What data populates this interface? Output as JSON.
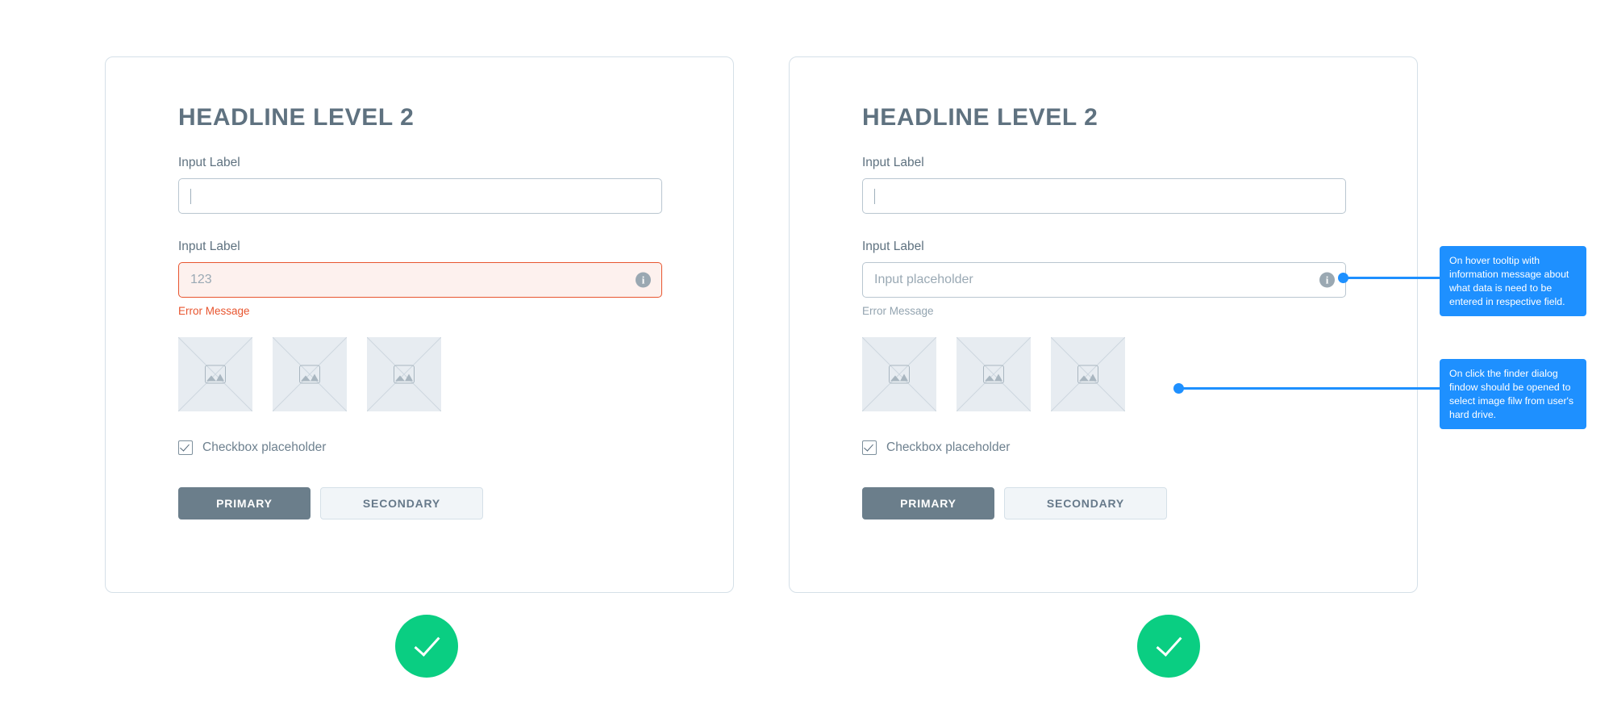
{
  "cards": [
    {
      "id": "left",
      "headline": "HEADLINE LEVEL 2",
      "field1": {
        "label": "Input Label",
        "value": "",
        "placeholder": ""
      },
      "field2": {
        "label": "Input Label",
        "value": "123",
        "placeholder": "",
        "state": "error",
        "info_icon": "info-icon"
      },
      "error_message": "Error Message",
      "thumbnails": [
        "image-placeholder",
        "image-placeholder",
        "image-placeholder"
      ],
      "checkbox": {
        "label": "Checkbox placeholder",
        "checked": true
      },
      "buttons": {
        "primary": "PRIMARY",
        "secondary": "SECONDARY"
      }
    },
    {
      "id": "right",
      "headline": "HEADLINE LEVEL 2",
      "field1": {
        "label": "Input Label",
        "value": "",
        "placeholder": ""
      },
      "field2": {
        "label": "Input Label",
        "value": "",
        "placeholder": "Input placeholder",
        "state": "default",
        "info_icon": "info-icon"
      },
      "error_message": "Error Message",
      "thumbnails": [
        "image-placeholder",
        "image-placeholder",
        "image-placeholder"
      ],
      "checkbox": {
        "label": "Checkbox placeholder",
        "checked": true
      },
      "buttons": {
        "primary": "PRIMARY",
        "secondary": "SECONDARY"
      }
    }
  ],
  "annotations": [
    {
      "id": "tooltip-1",
      "text": "On hover tooltip with information message about what data is need to be entered in respective field."
    },
    {
      "id": "tooltip-2",
      "text": "On click the finder dialog findow should be opened to select image filw from user's hard drive."
    }
  ],
  "success_badges": [
    {
      "id": "badge-left",
      "icon": "check-icon"
    },
    {
      "id": "badge-right",
      "icon": "check-icon"
    }
  ],
  "colors": {
    "accent_blue": "#1e90ff",
    "error_red": "#e8552f",
    "success_green": "#0ace82",
    "slate": "#6b7e8b",
    "card_border": "#d5e0e8",
    "placeholder_gray": "#9aa9b4"
  }
}
